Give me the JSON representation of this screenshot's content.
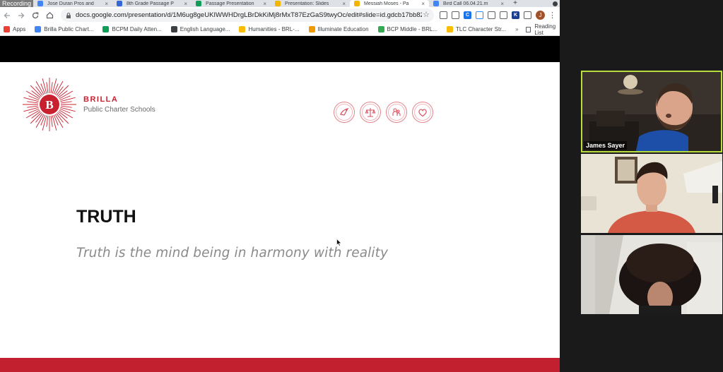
{
  "recording_label": "Recording",
  "tabs": [
    {
      "title": "Jose Duran Pros and",
      "color": "#4285f4",
      "active": false
    },
    {
      "title": "8th Grade Passage P",
      "color": "#3367d6",
      "active": false
    },
    {
      "title": "Passage Presentation",
      "color": "#0f9d58",
      "active": false
    },
    {
      "title": "Presentation: Slides",
      "color": "#f4b400",
      "active": false
    },
    {
      "title": "Messiah Moses - Pa",
      "color": "#f4b400",
      "active": true
    },
    {
      "title": "Bird Call 06.04.21.m",
      "color": "#4285f4",
      "active": false
    }
  ],
  "new_tab_label": "+",
  "url": "docs.google.com/presentation/d/1M6ug8geUKIWWHDrgLBrDkKiMj8rMxT87EzGaS9twyOc/edit#slide=id.gdcb17bb82c_0...",
  "extensions": [
    {
      "name": "shield-extension-icon",
      "color": "#5f6368",
      "label": ""
    },
    {
      "name": "filter-extension-icon",
      "color": "#5f6368",
      "label": ""
    },
    {
      "name": "c-extension-icon",
      "color": "#1a73e8",
      "label": "C"
    },
    {
      "name": "zoom-extension-icon",
      "color": "#2d8cff",
      "label": ""
    },
    {
      "name": "cast-extension-icon",
      "color": "#5f6368",
      "label": ""
    },
    {
      "name": "screen-extension-icon",
      "color": "#5f6368",
      "label": ""
    },
    {
      "name": "k-extension-icon",
      "color": "#1a3d8f",
      "label": "K"
    },
    {
      "name": "puzzle-extension-icon",
      "color": "#5f6368",
      "label": ""
    }
  ],
  "profile_initial": "J",
  "bookmarks": [
    {
      "label": "Apps",
      "color": "#ea4335"
    },
    {
      "label": "Brilla Public Chart...",
      "color": "#4285f4"
    },
    {
      "label": "BCPM Daily Atten...",
      "color": "#0f9d58"
    },
    {
      "label": "English Language...",
      "color": "#3c4043"
    },
    {
      "label": "Humanities - BRL-...",
      "color": "#fbbc04"
    },
    {
      "label": "Illuminate Education",
      "color": "#f29900"
    },
    {
      "label": "BCP Middle - BRL...",
      "color": "#34a853"
    },
    {
      "label": "TLC Character Str...",
      "color": "#fbbc04"
    }
  ],
  "bookmarks_more": "»",
  "reading_list_label": "Reading List",
  "slide": {
    "brand_name": "BRILLA",
    "brand_sub": "Public Charter Schools",
    "logo_letter": "B",
    "title": "TRUTH",
    "subtitle": "Truth is the mind being in harmony with reality",
    "virtue_icons": [
      "eagle-icon",
      "scales-icon",
      "family-icon",
      "heart-icon"
    ]
  },
  "colors": {
    "brand_red": "#c8202f",
    "active_speaker_border": "#b9dd3c"
  },
  "participants": [
    {
      "name": "James Sayer",
      "active_speaker": true
    },
    {
      "name": "",
      "active_speaker": false
    },
    {
      "name": "",
      "active_speaker": false
    }
  ]
}
